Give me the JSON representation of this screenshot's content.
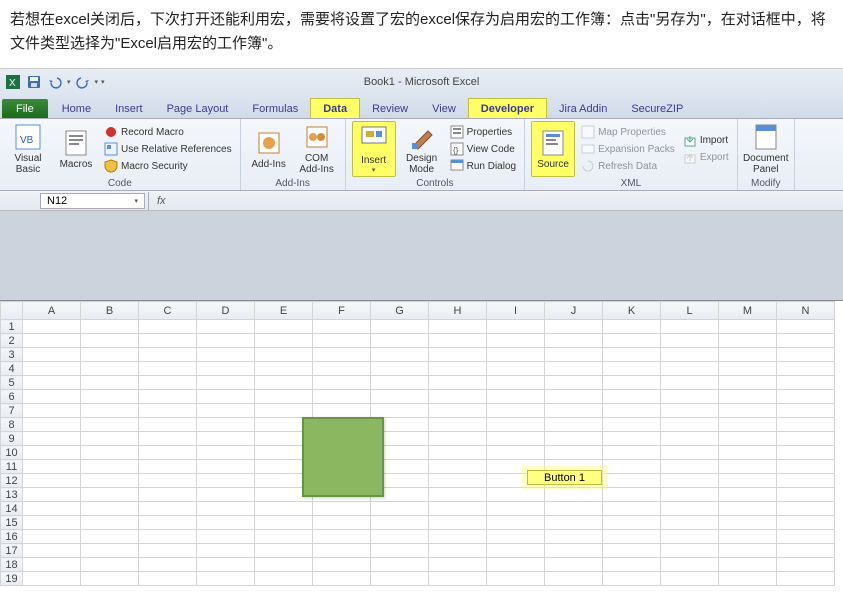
{
  "top_text": "若想在excel关闭后，下次打开还能利用宏，需要将设置了宏的excel保存为启用宏的工作簿：点击\"另存为\"，在对话框中，将文件类型选择为\"Excel启用宏的工作簿\"。",
  "title_bar": {
    "label": "Book1 - Microsoft Excel"
  },
  "tabs": {
    "file": "File",
    "items": [
      "Home",
      "Insert",
      "Page Layout",
      "Formulas",
      "Data",
      "Review",
      "View",
      "Developer",
      "Jira Addin",
      "SecureZIP"
    ],
    "highlighted": [
      "Data",
      "Developer"
    ]
  },
  "ribbon": {
    "code": {
      "visual_basic": "Visual\nBasic",
      "macros": "Macros",
      "record": "Record Macro",
      "relative": "Use Relative References",
      "security": "Macro Security",
      "label": "Code"
    },
    "addins": {
      "addins": "Add-Ins",
      "com": "COM\nAdd-Ins",
      "label": "Add-Ins"
    },
    "controls": {
      "insert": "Insert",
      "design": "Design\nMode",
      "properties": "Properties",
      "view_code": "View Code",
      "run_dialog": "Run Dialog",
      "label": "Controls"
    },
    "xml": {
      "source": "Source",
      "map_props": "Map Properties",
      "expansion": "Expansion Packs",
      "refresh": "Refresh Data",
      "import": "Import",
      "export": "Export",
      "label": "XML"
    },
    "modify": {
      "doc_panel": "Document\nPanel",
      "label": "Modify"
    }
  },
  "name_box": {
    "value": "N12"
  },
  "formula_bar": {
    "fx": "fx",
    "value": ""
  },
  "grid": {
    "cols": [
      "A",
      "B",
      "C",
      "D",
      "E",
      "F",
      "G",
      "H",
      "I",
      "J",
      "K",
      "L",
      "M",
      "N"
    ],
    "rows": [
      1,
      2,
      3,
      4,
      5,
      6,
      7,
      8,
      9,
      10,
      11,
      12,
      13,
      14,
      15,
      16,
      17,
      18,
      19
    ]
  },
  "shapes": {
    "button1_label": "Button 1"
  }
}
